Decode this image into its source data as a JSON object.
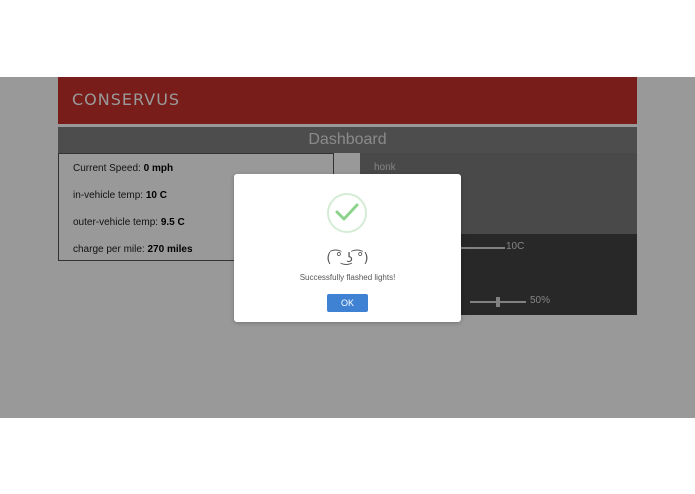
{
  "app": {
    "title": "CONSERVUS",
    "brand_color": "#c8312b"
  },
  "dashboard": {
    "title": "Dashboard"
  },
  "stats": [
    {
      "label": "Current Speed:",
      "value": "0 mph"
    },
    {
      "label": "in-vehicle temp:",
      "value": "10 C"
    },
    {
      "label": "outer-vehicle temp:",
      "value": "9.5 C"
    },
    {
      "label": "charge per mile:",
      "value": "270 miles"
    }
  ],
  "controls": {
    "honk_label": "honk",
    "temp_slider": {
      "value_text": "10C"
    },
    "percent_slider": {
      "value_text": "50%",
      "level": 0.5
    }
  },
  "modal": {
    "icon": "checkmark-icon",
    "face": "( ͡° ͜ʖ ͡°)",
    "message": "Successfully flashed lights!",
    "ok_label": "OK",
    "button_color": "#3f82d4",
    "check_color": "#8cd48c"
  }
}
